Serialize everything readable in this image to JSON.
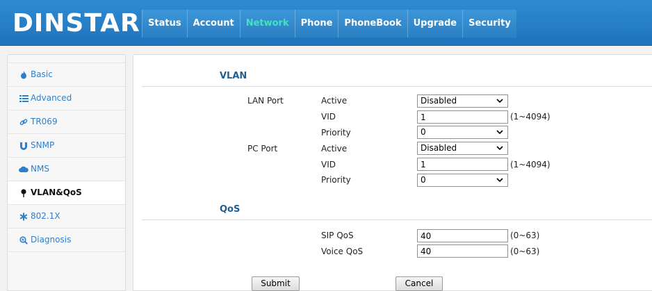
{
  "brand": {
    "logo_text": "DINSTAR"
  },
  "nav": {
    "items": [
      {
        "label": "Status"
      },
      {
        "label": "Account"
      },
      {
        "label": "Network",
        "active": true
      },
      {
        "label": "Phone"
      },
      {
        "label": "PhoneBook"
      },
      {
        "label": "Upgrade"
      },
      {
        "label": "Security"
      }
    ]
  },
  "sidebar": {
    "items": [
      {
        "label": "Basic",
        "icon": "fire-icon"
      },
      {
        "label": "Advanced",
        "icon": "list-icon"
      },
      {
        "label": "TR069",
        "icon": "link-icon"
      },
      {
        "label": "SNMP",
        "icon": "magnet-icon"
      },
      {
        "label": "NMS",
        "icon": "cloud-icon"
      },
      {
        "label": "VLAN&QoS",
        "icon": "pin-icon",
        "active": true
      },
      {
        "label": "802.1X",
        "icon": "asterisk-icon"
      },
      {
        "label": "Diagnosis",
        "icon": "zoom-icon"
      }
    ]
  },
  "vlan": {
    "title": "VLAN",
    "lan_port": {
      "label": "LAN Port",
      "active_label": "Active",
      "active_value": "Disabled",
      "vid_label": "VID",
      "vid_value": "1",
      "vid_hint": "(1~4094)",
      "priority_label": "Priority",
      "priority_value": "0"
    },
    "pc_port": {
      "label": "PC Port",
      "active_label": "Active",
      "active_value": "Disabled",
      "vid_label": "VID",
      "vid_value": "1",
      "vid_hint": "(1~4094)",
      "priority_label": "Priority",
      "priority_value": "0"
    }
  },
  "qos": {
    "title": "QoS",
    "sip_label": "SIP QoS",
    "sip_value": "40",
    "sip_hint": "(0~63)",
    "voice_label": "Voice QoS",
    "voice_value": "40",
    "voice_hint": "(0~63)"
  },
  "actions": {
    "submit_label": "Submit",
    "cancel_label": "Cancel"
  },
  "colors": {
    "header": "#2f8bd1",
    "nav_active": "#46e0c4",
    "side_link": "#2d7fcc",
    "section_title": "#1d5f95"
  }
}
